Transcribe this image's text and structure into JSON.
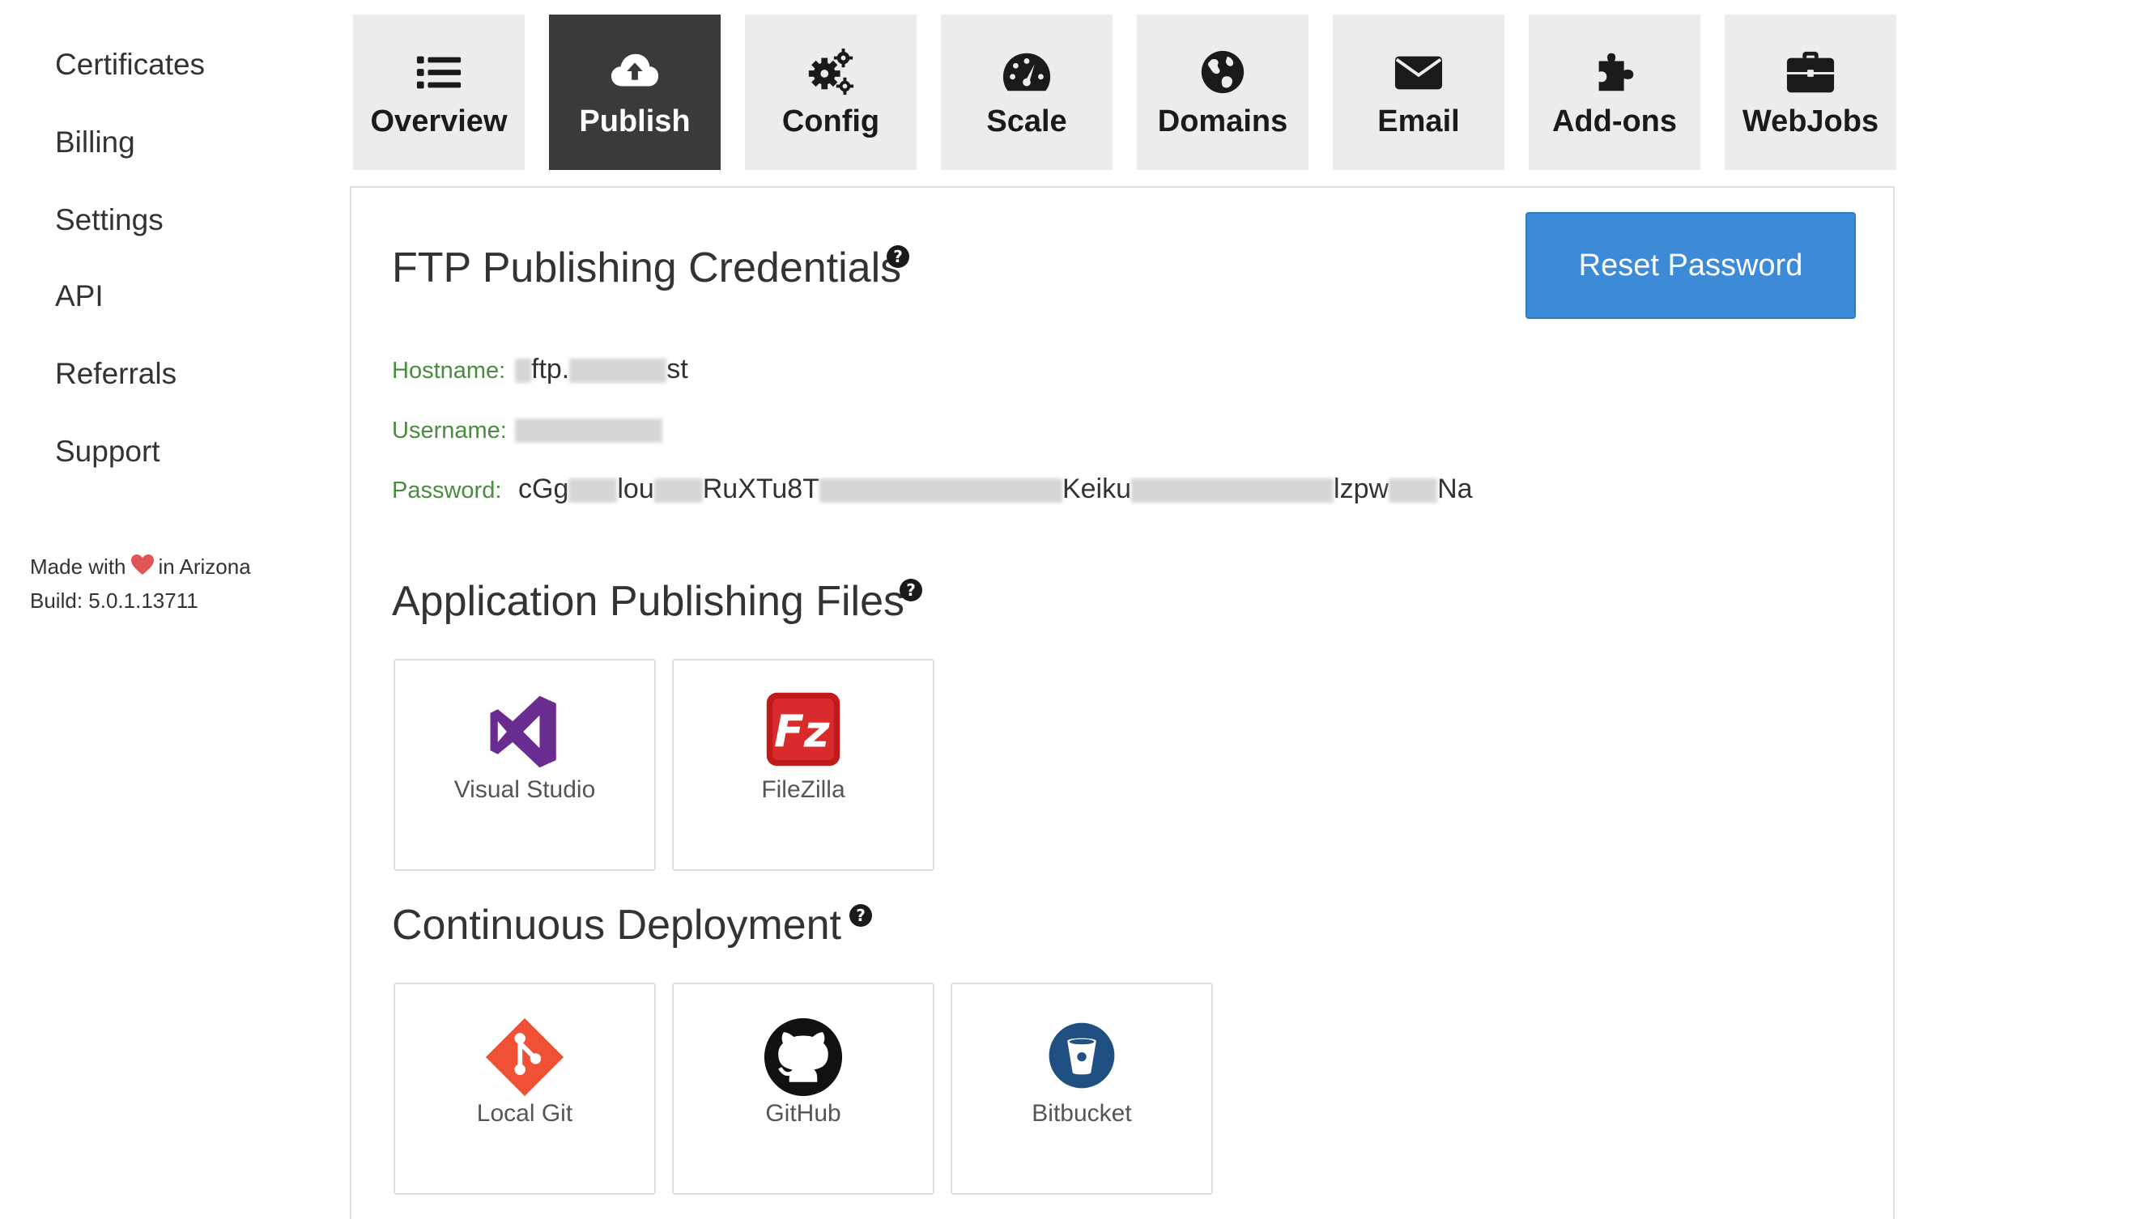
{
  "sidebar": {
    "items": [
      {
        "label": "Certificates"
      },
      {
        "label": "Billing"
      },
      {
        "label": "Settings"
      },
      {
        "label": "API"
      },
      {
        "label": "Referrals"
      },
      {
        "label": "Support"
      }
    ],
    "footer": {
      "made_with_prefix": "Made with",
      "made_with_suffix": "in Arizona",
      "build": "Build: 5.0.1.13711"
    }
  },
  "tabs": [
    {
      "label": "Overview",
      "icon": "list-icon",
      "active": false
    },
    {
      "label": "Publish",
      "icon": "cloud-upload-icon",
      "active": true
    },
    {
      "label": "Config",
      "icon": "gears-icon",
      "active": false
    },
    {
      "label": "Scale",
      "icon": "dashboard-icon",
      "active": false
    },
    {
      "label": "Domains",
      "icon": "globe-icon",
      "active": false
    },
    {
      "label": "Email",
      "icon": "envelope-icon",
      "active": false
    },
    {
      "label": "Add-ons",
      "icon": "puzzle-icon",
      "active": false
    },
    {
      "label": "WebJobs",
      "icon": "briefcase-icon",
      "active": false
    }
  ],
  "ftp": {
    "title": "FTP Publishing Credentials",
    "reset_button": "Reset Password",
    "hostname_label": "Hostname:",
    "hostname_visible": [
      "ftp.",
      "st"
    ],
    "username_label": "Username:",
    "username_visible": [
      "..."
    ],
    "password_label": "Password:",
    "password_visible": [
      "cGg",
      "lou",
      "RuXTu8T",
      "Keiku",
      "lzpw",
      "Na"
    ]
  },
  "app_files": {
    "title": "Application Publishing Files",
    "cards": [
      {
        "label": "Visual Studio",
        "icon": "visual-studio-icon"
      },
      {
        "label": "FileZilla",
        "icon": "filezilla-icon"
      }
    ]
  },
  "deployment": {
    "title": "Continuous Deployment",
    "cards": [
      {
        "label": "Local Git",
        "icon": "git-icon"
      },
      {
        "label": "GitHub",
        "icon": "github-icon"
      },
      {
        "label": "Bitbucket",
        "icon": "bitbucket-icon"
      }
    ]
  },
  "colors": {
    "active_tab": "#3a3a3a",
    "tab_bg": "#ececec",
    "reset_button": "#3d8ad6",
    "label_green": "#4a8c3f",
    "heart": "#e05555"
  }
}
